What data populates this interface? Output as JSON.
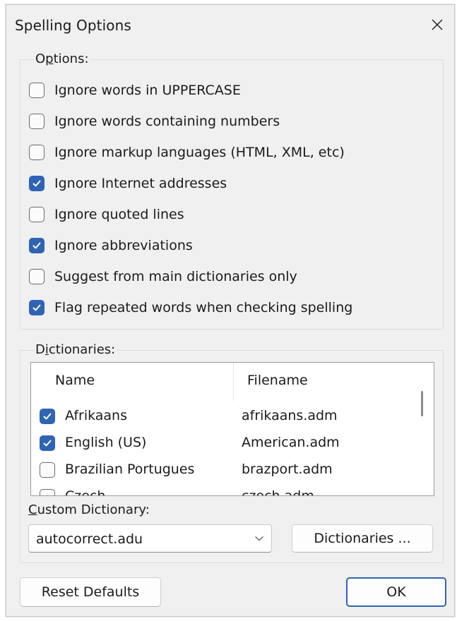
{
  "window": {
    "title": "Spelling Options"
  },
  "options": {
    "group_label_pre": "O",
    "group_label_mn": "p",
    "group_label_post": "tions:",
    "items": [
      {
        "label": "Ignore words in UPPERCASE",
        "checked": false
      },
      {
        "label": "Ignore words containing numbers",
        "checked": false
      },
      {
        "label": "Ignore markup languages (HTML, XML, etc)",
        "checked": false
      },
      {
        "label": "Ignore Internet addresses",
        "checked": true
      },
      {
        "label": "Ignore quoted lines",
        "checked": false
      },
      {
        "label": "Ignore abbreviations",
        "checked": true
      },
      {
        "label": "Suggest from main dictionaries only",
        "checked": false
      },
      {
        "label": "Flag repeated words when checking spelling",
        "checked": true
      }
    ]
  },
  "dictionaries": {
    "group_label_pre": "D",
    "group_label_mn": "i",
    "group_label_post": "ctionaries:",
    "columns": {
      "name": "Name",
      "filename": "Filename"
    },
    "rows": [
      {
        "name": "Afrikaans",
        "file": "afrikaans.adm",
        "checked": true
      },
      {
        "name": "English (US)",
        "file": "American.adm",
        "checked": true
      },
      {
        "name": "Brazilian Portugues",
        "file": "brazport.adm",
        "checked": false
      },
      {
        "name": "Czech",
        "file": "czech.adm",
        "checked": false
      }
    ]
  },
  "custom_dictionary": {
    "label_mn": "C",
    "label_post": "ustom Dictionary:",
    "value": "autocorrect.adu"
  },
  "buttons": {
    "dictionaries": "Dictionaries ...",
    "reset": "Reset Defaults",
    "ok": "OK"
  },
  "colors": {
    "accent": "#2f64b4",
    "dialog_bg": "#f0f0f0"
  },
  "icons": {
    "close": "close-icon",
    "check": "checkmark-icon",
    "dropdown": "chevron-down-icon"
  }
}
